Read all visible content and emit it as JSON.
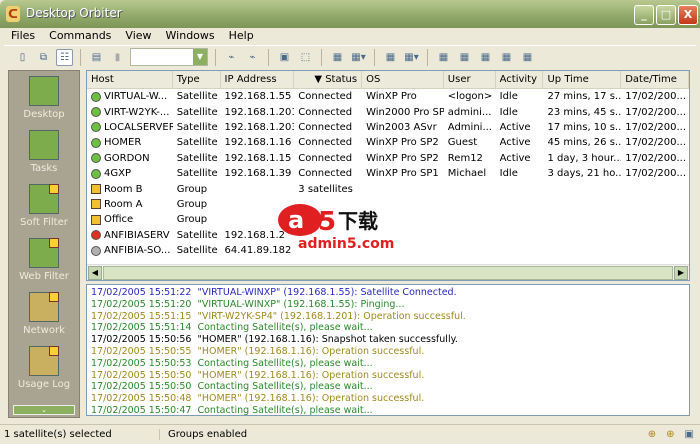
{
  "window": {
    "title": "Desktop Orbiter",
    "minimize": "_",
    "maximize": "□",
    "close": "X"
  },
  "menu": [
    "Files",
    "Commands",
    "View",
    "Windows",
    "Help"
  ],
  "sidebar": {
    "items": [
      {
        "label": "Desktop",
        "tan": false,
        "badge": false
      },
      {
        "label": "Tasks",
        "tan": false,
        "badge": false
      },
      {
        "label": "Soft Filter",
        "tan": false,
        "badge": true
      },
      {
        "label": "Web Filter",
        "tan": false,
        "badge": true
      },
      {
        "label": "Network",
        "tan": true,
        "badge": true
      },
      {
        "label": "Usage Log",
        "tan": true,
        "badge": true
      }
    ],
    "more": "⌄"
  },
  "list": {
    "columns": [
      "Host",
      "Type",
      "IP Address",
      "▼ Status",
      "OS",
      "User",
      "Activity",
      "Up Time",
      "Date/Time"
    ],
    "rows": [
      {
        "status": "green",
        "host": "VIRTUAL-W...",
        "type": "Satellite",
        "ip": "192.168.1.55",
        "conn": "Connected",
        "os": "WinXP Pro",
        "user": "<logon>",
        "activity": "Idle",
        "uptime": "27 mins, 17 s...",
        "date": "17/02/200..."
      },
      {
        "status": "green",
        "host": "VIRT-W2YK-...",
        "type": "Satellite",
        "ip": "192.168.1.201",
        "conn": "Connected",
        "os": "Win2000 Pro SP4",
        "user": "admini...",
        "activity": "Idle",
        "uptime": "23 mins, 45 s...",
        "date": "17/02/200..."
      },
      {
        "status": "green",
        "host": "LOCALSERVER",
        "type": "Satellite",
        "ip": "192.168.1.203",
        "conn": "Connected",
        "os": "Win2003 ASvr",
        "user": "Admini...",
        "activity": "Active",
        "uptime": "17 mins, 10 s...",
        "date": "17/02/200..."
      },
      {
        "status": "green",
        "host": "HOMER",
        "type": "Satellite",
        "ip": "192.168.1.16",
        "conn": "Connected",
        "os": "WinXP Pro SP2",
        "user": "Guest",
        "activity": "Active",
        "uptime": "45 mins, 26 s...",
        "date": "17/02/200..."
      },
      {
        "status": "green",
        "host": "GORDON",
        "type": "Satellite",
        "ip": "192.168.1.15",
        "conn": "Connected",
        "os": "WinXP Pro SP2",
        "user": "Rem12",
        "activity": "Active",
        "uptime": "1 day, 3 hour...",
        "date": "17/02/200..."
      },
      {
        "status": "green",
        "host": "4GXP",
        "type": "Satellite",
        "ip": "192.168.1.39",
        "conn": "Connected",
        "os": "WinXP Pro SP1",
        "user": "Michael",
        "activity": "Idle",
        "uptime": "3 days, 21 ho...",
        "date": "17/02/200..."
      },
      {
        "status": "group",
        "host": "Room B",
        "type": "Group",
        "ip": "",
        "conn": "3 satellites",
        "os": "",
        "user": "",
        "activity": "",
        "uptime": "",
        "date": ""
      },
      {
        "status": "group",
        "host": "Room A",
        "type": "Group",
        "ip": "",
        "conn": "",
        "os": "",
        "user": "",
        "activity": "",
        "uptime": "",
        "date": ""
      },
      {
        "status": "group",
        "host": "Office",
        "type": "Group",
        "ip": "",
        "conn": "",
        "os": "",
        "user": "",
        "activity": "",
        "uptime": "",
        "date": ""
      },
      {
        "status": "red",
        "host": "ANFIBIASERV",
        "type": "Satellite",
        "ip": "192.168.1.2",
        "conn": "",
        "os": "",
        "user": "",
        "activity": "",
        "uptime": "",
        "date": ""
      },
      {
        "status": "gray",
        "host": "ANFIBIA-SO...",
        "type": "Satellite",
        "ip": "64.41.89.182",
        "conn": "",
        "os": "",
        "user": "",
        "activity": "",
        "uptime": "",
        "date": ""
      }
    ]
  },
  "colors": {
    "green": "#6cc040",
    "red": "#e03020",
    "gray": "#b0b0b0",
    "log_blue": "#2828c0",
    "log_green": "#2a8a2a",
    "log_olive": "#a08a20",
    "log_black": "#000000"
  },
  "log": [
    {
      "color": "log_blue",
      "text": "17/02/2005 15:51:22  \"VIRTUAL-WINXP\" (192.168.1.55): Satellite Connected."
    },
    {
      "color": "log_green",
      "text": "17/02/2005 15:51:20  \"VIRTUAL-WINXP\" (192.168.1.55): Pinging..."
    },
    {
      "color": "log_olive",
      "text": "17/02/2005 15:51:15  \"VIRT-W2YK-SP4\" (192.168.1.201): Operation successful."
    },
    {
      "color": "log_green",
      "text": "17/02/2005 15:51:14  Contacting Satellite(s), please wait..."
    },
    {
      "color": "log_black",
      "text": "17/02/2005 15:50:56  \"HOMER\" (192.168.1.16): Snapshot taken successfully."
    },
    {
      "color": "log_olive",
      "text": "17/02/2005 15:50:55  \"HOMER\" (192.168.1.16): Operation successful."
    },
    {
      "color": "log_green",
      "text": "17/02/2005 15:50:53  Contacting Satellite(s), please wait..."
    },
    {
      "color": "log_olive",
      "text": "17/02/2005 15:50:50  \"HOMER\" (192.168.1.16): Operation successful."
    },
    {
      "color": "log_green",
      "text": "17/02/2005 15:50:50  Contacting Satellite(s), please wait..."
    },
    {
      "color": "log_olive",
      "text": "17/02/2005 15:50:48  \"HOMER\" (192.168.1.16): Operation successful."
    },
    {
      "color": "log_green",
      "text": "17/02/2005 15:50:47  Contacting Satellite(s), please wait..."
    }
  ],
  "status": {
    "selected": "1 satellite(s) selected",
    "groups": "Groups enabled"
  },
  "watermark": {
    "text": "a5下载",
    "url": "admin5.com"
  }
}
